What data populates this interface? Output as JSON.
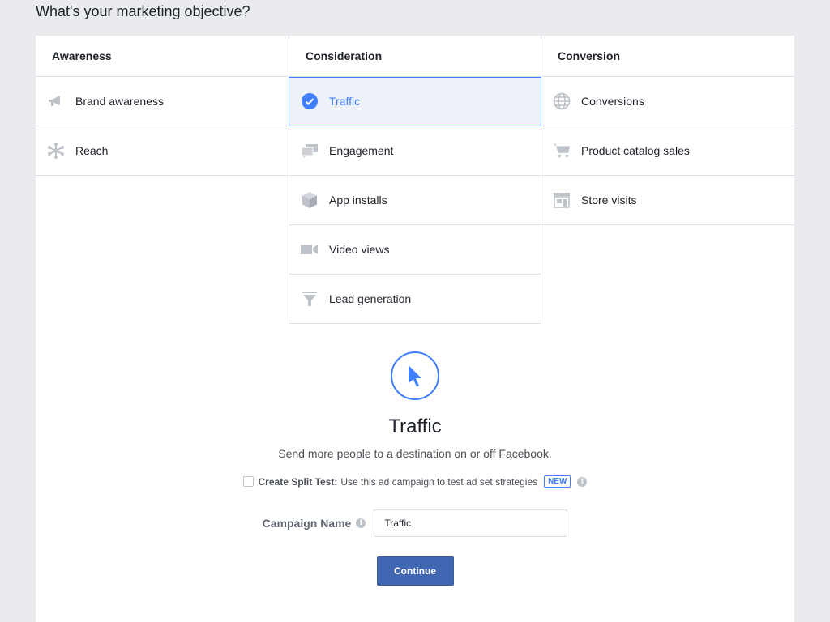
{
  "page_title": "What's your marketing objective?",
  "columns": [
    {
      "header": "Awareness",
      "options": [
        {
          "label": "Brand awareness",
          "icon": "megaphone-icon"
        },
        {
          "label": "Reach",
          "icon": "reach-icon"
        }
      ]
    },
    {
      "header": "Consideration",
      "options": [
        {
          "label": "Traffic",
          "icon": "check-circle-icon",
          "selected": true
        },
        {
          "label": "Engagement",
          "icon": "speech-bubbles-icon"
        },
        {
          "label": "App installs",
          "icon": "box-icon"
        },
        {
          "label": "Video views",
          "icon": "video-camera-icon"
        },
        {
          "label": "Lead generation",
          "icon": "funnel-icon"
        }
      ]
    },
    {
      "header": "Conversion",
      "options": [
        {
          "label": "Conversions",
          "icon": "globe-icon"
        },
        {
          "label": "Product catalog sales",
          "icon": "cart-icon"
        },
        {
          "label": "Store visits",
          "icon": "store-icon"
        }
      ]
    }
  ],
  "detail": {
    "icon": "cursor-icon",
    "title": "Traffic",
    "description": "Send more people to a destination on or off Facebook."
  },
  "split_test": {
    "bold_label": "Create Split Test:",
    "text": "Use this ad campaign to test ad set strategies",
    "badge": "NEW",
    "checked": false
  },
  "campaign_name": {
    "label": "Campaign Name",
    "value": "Traffic"
  },
  "continue_label": "Continue",
  "colors": {
    "accent": "#4080ff",
    "button": "#4267b2",
    "icon_gray": "#bec2c9",
    "background": "#e9ebee"
  }
}
